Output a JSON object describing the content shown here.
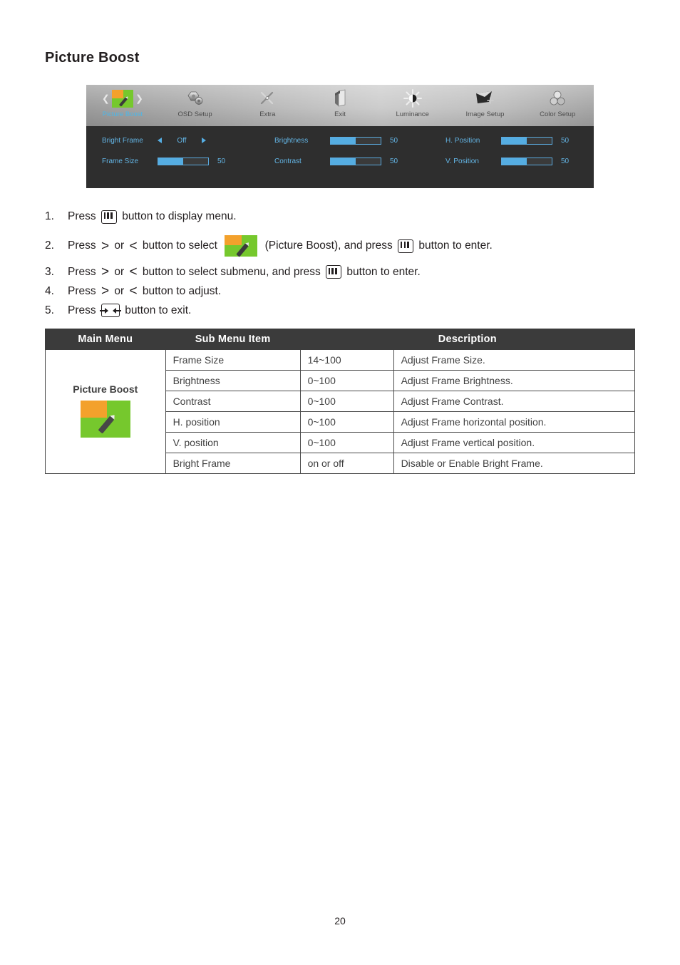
{
  "page": {
    "title": "Picture Boost",
    "number": "20"
  },
  "osd": {
    "menu_items": [
      {
        "label": "Picture Boost",
        "icon": "picture-boost-icon",
        "selected": true
      },
      {
        "label": "OSD Setup",
        "icon": "osd-setup-icon",
        "selected": false
      },
      {
        "label": "Extra",
        "icon": "extra-tools-icon",
        "selected": false
      },
      {
        "label": "Exit",
        "icon": "exit-door-icon",
        "selected": false
      },
      {
        "label": "Luminance",
        "icon": "luminance-sun-icon",
        "selected": false
      },
      {
        "label": "Image Setup",
        "icon": "image-setup-icon",
        "selected": false
      },
      {
        "label": "Color Setup",
        "icon": "color-setup-icon",
        "selected": false
      }
    ],
    "nav_prev_icon": "chevron-left-icon",
    "nav_next_icon": "chevron-right-icon",
    "selected_label_color": "#4cb7e8",
    "settings": {
      "bright_frame": {
        "label": "Bright Frame",
        "value": "Off"
      },
      "frame_size": {
        "label": "Frame Size",
        "value": "50",
        "fill_percent": 50
      },
      "brightness": {
        "label": "Brightness",
        "value": "50",
        "fill_percent": 50
      },
      "contrast": {
        "label": "Contrast",
        "value": "50",
        "fill_percent": 50
      },
      "h_position": {
        "label": "H. Position",
        "value": "50",
        "fill_percent": 50
      },
      "v_position": {
        "label": "V. Position",
        "value": "50",
        "fill_percent": 50
      }
    }
  },
  "steps": {
    "s1": {
      "num": "1.",
      "a": "Press ",
      "b": " button to display menu."
    },
    "s2": {
      "num": "2.",
      "a": "Press ",
      "b": " or ",
      "c": " button to select ",
      "d": " (Picture Boost), and press ",
      "e": " button to enter."
    },
    "s3": {
      "num": "3.",
      "a": "Press ",
      "b": " or ",
      "c": " button to select submenu, and press ",
      "d": " button to enter."
    },
    "s4": {
      "num": "4.",
      "a": "Press ",
      "b": " or ",
      "c": " button to adjust."
    },
    "s5": {
      "num": "5.",
      "a": "Press ",
      "b": " button to exit."
    },
    "glyph_right": ">",
    "glyph_left": "<"
  },
  "table": {
    "headers": {
      "main_menu": "Main Menu",
      "sub_menu_item": "Sub Menu Item",
      "description": "Description"
    },
    "main_menu_label": "Picture Boost",
    "rows": [
      {
        "item": "Frame Size",
        "range": "14~100",
        "description": "Adjust Frame Size."
      },
      {
        "item": "Brightness",
        "range": "0~100",
        "description": "Adjust Frame Brightness."
      },
      {
        "item": "Contrast",
        "range": "0~100",
        "description": "Adjust Frame Contrast."
      },
      {
        "item": "H. position",
        "range": "0~100",
        "description": "Adjust Frame horizontal position."
      },
      {
        "item": "V. position",
        "range": "0~100",
        "description": "Adjust Frame vertical position."
      },
      {
        "item": "Bright Frame",
        "range": "on or off",
        "description": "Disable or Enable Bright Frame."
      }
    ]
  },
  "colors": {
    "orange": "#f3a12c",
    "green": "#76c82d",
    "osd_blue": "#63b5e5",
    "osd_dark": "#2e2e2e",
    "table_header": "#3b3b3b"
  }
}
